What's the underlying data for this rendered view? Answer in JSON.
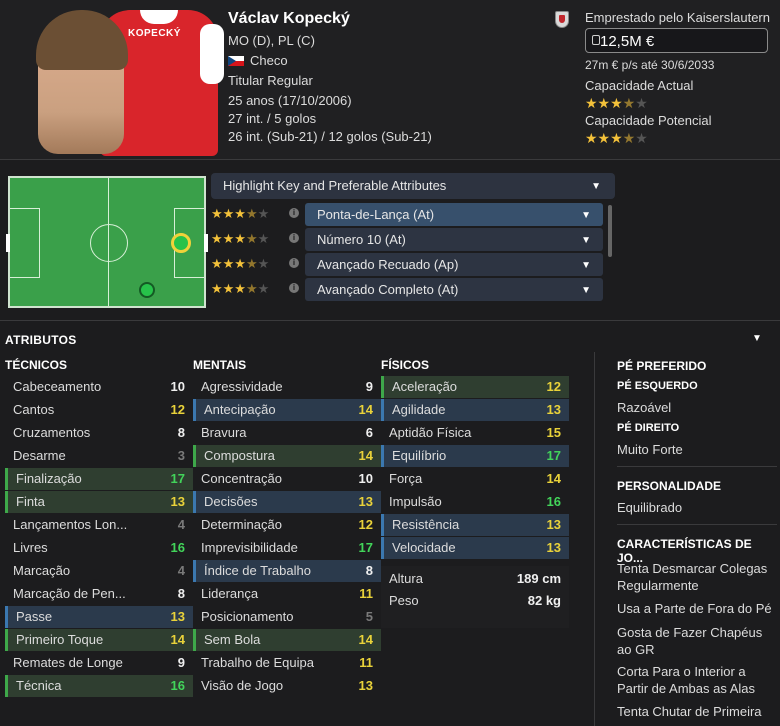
{
  "player": {
    "name": "Václav Kopecký",
    "shirt_name": "KOPECKÝ",
    "positions": "MO (D), PL (C)",
    "nationality": "Checo",
    "status": "Titular Regular",
    "age": "25 anos (17/10/2006)",
    "caps": "27 int. / 5 golos",
    "u21_caps": "26 int. (Sub-21) / 12 golos (Sub-21)",
    "loan_text": "Emprestado pelo Kaiserslautern",
    "value": "12,5M €",
    "wage": "27m € p/s até 30/6/2033",
    "current_ability_label": "Capacidade Actual",
    "current_ability_stars": 3.5,
    "potential_ability_label": "Capacidade Potencial",
    "potential_ability_stars": 3.5
  },
  "roles_panel": {
    "header": "Highlight Key and Preferable Attributes",
    "roles": [
      {
        "label": "Ponta-de-Lança (At)",
        "stars": 3.5,
        "selected": true
      },
      {
        "label": "Número 10 (At)",
        "stars": 3.5,
        "selected": false
      },
      {
        "label": "Avançado Recuado (Ap)",
        "stars": 3.5,
        "selected": false
      },
      {
        "label": "Avançado Completo (At)",
        "stars": 3.5,
        "selected": false
      }
    ]
  },
  "attributes": {
    "title": "ATRIBUTOS",
    "technical": {
      "header": "TÉCNICOS",
      "items": [
        {
          "name": "Cabeceamento",
          "value": "10",
          "hl": ""
        },
        {
          "name": "Cantos",
          "value": "12",
          "hl": ""
        },
        {
          "name": "Cruzamentos",
          "value": "8",
          "hl": ""
        },
        {
          "name": "Desarme",
          "value": "3",
          "hl": ""
        },
        {
          "name": "Finalização",
          "value": "17",
          "hl": "g"
        },
        {
          "name": "Finta",
          "value": "13",
          "hl": "g"
        },
        {
          "name": "Lançamentos Lon...",
          "value": "4",
          "hl": ""
        },
        {
          "name": "Livres",
          "value": "16",
          "hl": ""
        },
        {
          "name": "Marcação",
          "value": "4",
          "hl": ""
        },
        {
          "name": "Marcação de Pen...",
          "value": "8",
          "hl": ""
        },
        {
          "name": "Passe",
          "value": "13",
          "hl": "b"
        },
        {
          "name": "Primeiro Toque",
          "value": "14",
          "hl": "g"
        },
        {
          "name": "Remates de Longe",
          "value": "9",
          "hl": ""
        },
        {
          "name": "Técnica",
          "value": "16",
          "hl": "g"
        }
      ]
    },
    "mental": {
      "header": "MENTAIS",
      "items": [
        {
          "name": "Agressividade",
          "value": "9",
          "hl": ""
        },
        {
          "name": "Antecipação",
          "value": "14",
          "hl": "b"
        },
        {
          "name": "Bravura",
          "value": "6",
          "hl": ""
        },
        {
          "name": "Compostura",
          "value": "14",
          "hl": "g"
        },
        {
          "name": "Concentração",
          "value": "10",
          "hl": ""
        },
        {
          "name": "Decisões",
          "value": "13",
          "hl": "b"
        },
        {
          "name": "Determinação",
          "value": "12",
          "hl": ""
        },
        {
          "name": "Imprevisibilidade",
          "value": "17",
          "hl": ""
        },
        {
          "name": "Índice de Trabalho",
          "value": "8",
          "hl": "b"
        },
        {
          "name": "Liderança",
          "value": "11",
          "hl": ""
        },
        {
          "name": "Posicionamento",
          "value": "5",
          "hl": ""
        },
        {
          "name": "Sem Bola",
          "value": "14",
          "hl": "g"
        },
        {
          "name": "Trabalho de Equipa",
          "value": "11",
          "hl": ""
        },
        {
          "name": "Visão de Jogo",
          "value": "13",
          "hl": ""
        }
      ]
    },
    "physical": {
      "header": "FÍSICOS",
      "items": [
        {
          "name": "Aceleração",
          "value": "12",
          "hl": "g"
        },
        {
          "name": "Agilidade",
          "value": "13",
          "hl": "b"
        },
        {
          "name": "Aptidão Física",
          "value": "15",
          "hl": ""
        },
        {
          "name": "Equilíbrio",
          "value": "17",
          "hl": "b"
        },
        {
          "name": "Força",
          "value": "14",
          "hl": ""
        },
        {
          "name": "Impulsão",
          "value": "16",
          "hl": ""
        },
        {
          "name": "Resistência",
          "value": "13",
          "hl": "b"
        },
        {
          "name": "Velocidade",
          "value": "13",
          "hl": "b"
        }
      ],
      "height_label": "Altura",
      "height_value": "189 cm",
      "weight_label": "Peso",
      "weight_value": "82 kg"
    }
  },
  "side": {
    "foot_header": "PÉ PREFERIDO",
    "left_foot_label": "PÉ ESQUERDO",
    "left_foot_value": "Razoável",
    "right_foot_label": "PÉ DIREITO",
    "right_foot_value": "Muito Forte",
    "personality_header": "PERSONALIDADE",
    "personality_value": "Equilibrado",
    "traits_header": "CARACTERÍSTICAS DE JO...",
    "traits": [
      "Tenta Desmarcar Colegas Regularmente",
      "Usa a Parte de Fora do Pé",
      "Gosta de Fazer Chapéus ao GR",
      "Corta Para o Interior a Partir de Ambas as Alas",
      "Tenta Chutar de Primeira"
    ]
  },
  "colors": {
    "green_highlight": "#2f3e30",
    "blue_highlight": "#2b3a4c",
    "star": "#f3c13a"
  }
}
